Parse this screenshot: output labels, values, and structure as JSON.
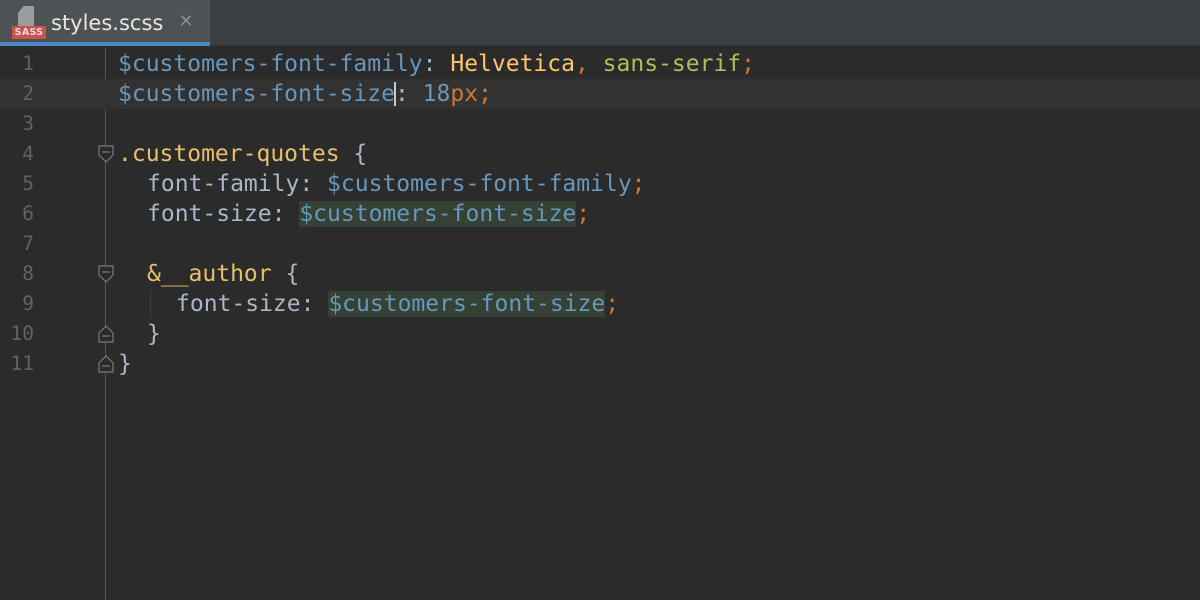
{
  "tab": {
    "filename": "styles.scss",
    "icon_badge": "SASS",
    "icon": "sass-file-icon",
    "close_icon": "close-icon"
  },
  "editor": {
    "cursor_line": 2,
    "lines": [
      {
        "number": "1",
        "tokens": [
          {
            "text": "$customers-font-family",
            "kind": "var"
          },
          {
            "text": ": ",
            "kind": "plain"
          },
          {
            "text": "Helvetica",
            "kind": "str"
          },
          {
            "text": ", ",
            "kind": "punct"
          },
          {
            "text": "sans-serif",
            "kind": "kw"
          },
          {
            "text": ";",
            "kind": "punct"
          }
        ]
      },
      {
        "number": "2",
        "tokens": [
          {
            "text": "$customers-font-size",
            "kind": "var"
          },
          {
            "text": "|",
            "kind": "caret"
          },
          {
            "text": ": ",
            "kind": "plain"
          },
          {
            "text": "18",
            "kind": "num"
          },
          {
            "text": "px",
            "kind": "unit"
          },
          {
            "text": ";",
            "kind": "punct"
          }
        ]
      },
      {
        "number": "3",
        "tokens": []
      },
      {
        "number": "4",
        "tokens": [
          {
            "text": ".customer-quotes",
            "kind": "selector"
          },
          {
            "text": " {",
            "kind": "plain"
          }
        ]
      },
      {
        "number": "5",
        "tokens": [
          {
            "text": "font-family",
            "kind": "prop"
          },
          {
            "text": ": ",
            "kind": "plain"
          },
          {
            "text": "$customers-font-family",
            "kind": "var"
          },
          {
            "text": ";",
            "kind": "punct"
          }
        ]
      },
      {
        "number": "6",
        "tokens": [
          {
            "text": "font-size",
            "kind": "prop"
          },
          {
            "text": ": ",
            "kind": "plain"
          },
          {
            "text": "$customers-font-size",
            "kind": "var-hl"
          },
          {
            "text": ";",
            "kind": "punct"
          }
        ]
      },
      {
        "number": "7",
        "tokens": []
      },
      {
        "number": "8",
        "tokens": [
          {
            "text": "&__author",
            "kind": "amp"
          },
          {
            "text": " {",
            "kind": "plain"
          }
        ]
      },
      {
        "number": "9",
        "tokens": [
          {
            "text": "font-size",
            "kind": "prop"
          },
          {
            "text": ": ",
            "kind": "plain"
          },
          {
            "text": "$customers-font-size",
            "kind": "var-hl"
          },
          {
            "text": ";",
            "kind": "punct"
          }
        ]
      },
      {
        "number": "10",
        "tokens": [
          {
            "text": "}",
            "kind": "plain"
          }
        ]
      },
      {
        "number": "11",
        "tokens": [
          {
            "text": "}",
            "kind": "plain"
          }
        ]
      }
    ]
  },
  "colors": {
    "background": "#2b2b2b",
    "current_line": "#323232",
    "tab_active": "#4e5254",
    "tab_underline": "#4a88c7",
    "variable": "#6897bb",
    "selector": "#e8bf6a",
    "string": "#ffc66d",
    "keyword": "#a5c25c",
    "punctuation": "#cc7832",
    "usage_highlight": "#344134"
  }
}
